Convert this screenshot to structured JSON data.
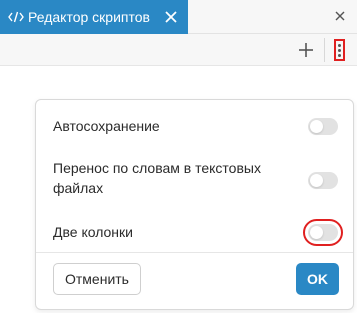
{
  "tab": {
    "title": "Редактор скриптов",
    "icon": "code-icon",
    "close_icon": "close-icon"
  },
  "window": {
    "close_icon": "close-icon"
  },
  "toolbar": {
    "add_icon": "plus-icon",
    "more_icon": "more-vertical-icon"
  },
  "dialog": {
    "options": [
      {
        "label": "Автосохранение",
        "enabled": false
      },
      {
        "label": "Перенос по словам в текстовых файлах",
        "enabled": false
      },
      {
        "label": "Две колонки",
        "enabled": false
      }
    ],
    "cancel_label": "Отменить",
    "ok_label": "OK"
  },
  "colors": {
    "accent": "#2a88c5",
    "toggle_off": "#e2e2e2",
    "highlight": "#e02020"
  }
}
